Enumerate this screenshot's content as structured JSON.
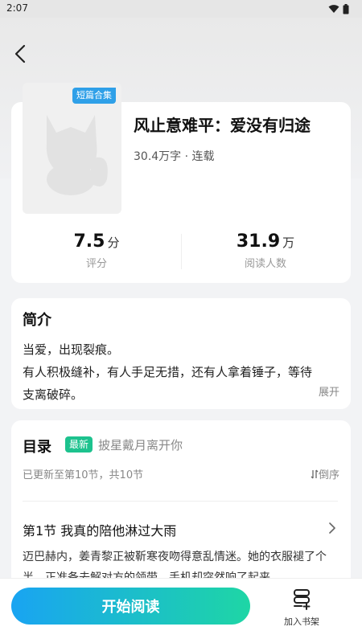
{
  "status_bar": {
    "time": "2:07"
  },
  "book": {
    "badge": "短篇合集",
    "title": "风止意难平：爱没有归途",
    "meta": "30.4万字 · 连载",
    "rating": {
      "value": "7.5",
      "unit": "分",
      "label": "评分"
    },
    "readers": {
      "value": "31.9",
      "unit": "万",
      "label": "阅读人数"
    }
  },
  "intro": {
    "title": "简介",
    "lines": [
      "当爱，出现裂痕。",
      "有人积极缝补，有人手足无措，还有人拿着锤子，等待",
      "支离破碎。"
    ],
    "expand_label": "展开"
  },
  "toc": {
    "title": "目录",
    "latest_badge": "最新",
    "latest_chapter": "披星戴月离开你",
    "update_info": "已更新至第10节，共10节",
    "sort_label": "倒序",
    "first_chapter": {
      "title": "第1节 我真的陪他淋过大雨",
      "preview_lines": [
        "迈巴赫内，姜青黎正被靳寒夜吻得意乱情迷。她的衣服褪了个",
        "半，正准备去解对方的领带，手机却突然响了起来……"
      ]
    }
  },
  "actions": {
    "start_reading": "开始阅读",
    "add_to_shelf": "加入书架"
  },
  "colors": {
    "badge_blue": "#2fa0e8",
    "latest_green": "#1dc28e",
    "button_gradient_start": "#19a4f2",
    "button_gradient_end": "#1ed6a5"
  },
  "icons": [
    "wifi-icon",
    "battery-icon",
    "back-arrow-icon",
    "cover-placeholder-icon",
    "sort-icon",
    "chevron-right-icon",
    "bookshelf-add-icon"
  ]
}
